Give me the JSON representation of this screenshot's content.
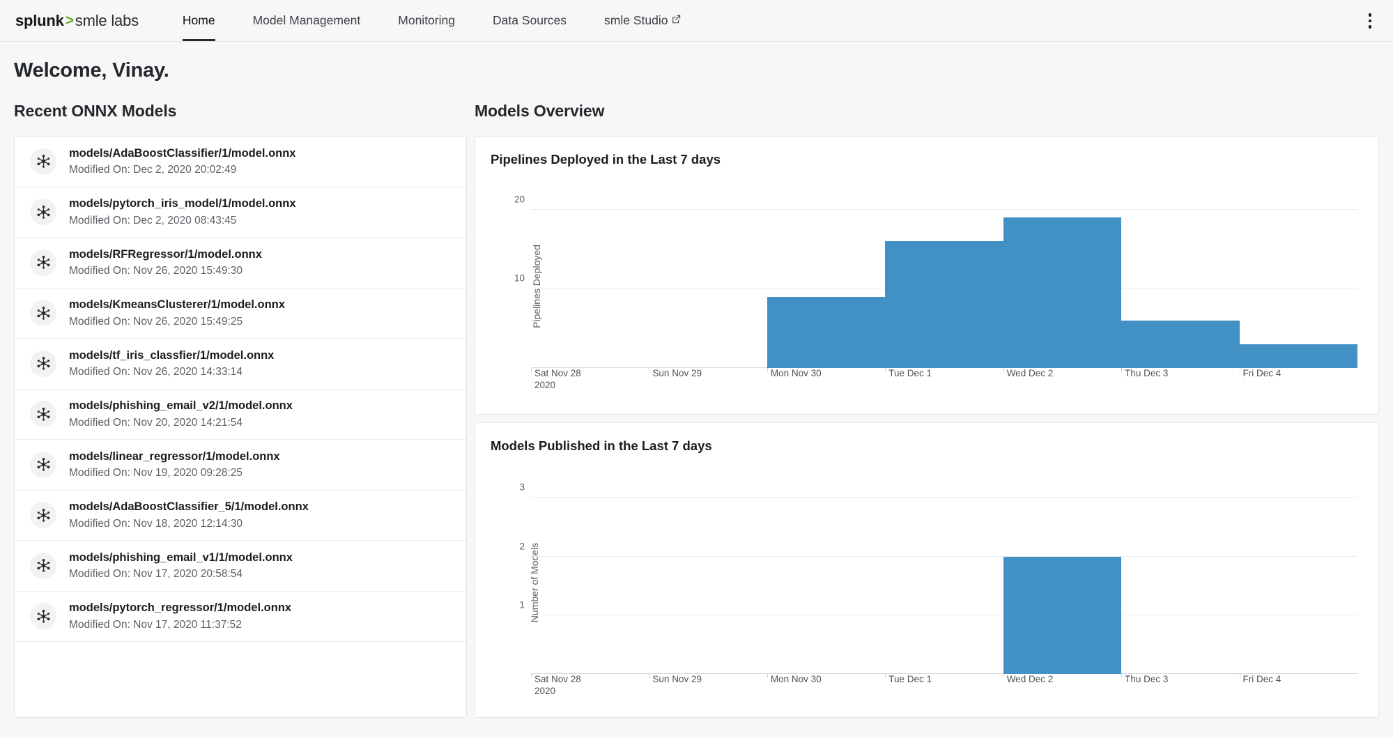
{
  "nav": {
    "brand": {
      "splunk": "splunk",
      "chevron": ">",
      "smle": "smle labs"
    },
    "items": [
      {
        "label": "Home",
        "active": true,
        "external": false
      },
      {
        "label": "Model Management",
        "active": false,
        "external": false
      },
      {
        "label": "Monitoring",
        "active": false,
        "external": false
      },
      {
        "label": "Data Sources",
        "active": false,
        "external": false
      },
      {
        "label": "smle Studio",
        "active": false,
        "external": true
      }
    ],
    "menu_icon": "kebab-menu-icon"
  },
  "page": {
    "welcome": "Welcome, Vinay.",
    "left_section_title": "Recent ONNX Models",
    "right_section_title": "Models Overview"
  },
  "models": [
    {
      "name": "models/AdaBoostClassifier/1/model.onnx",
      "modified": "Modified On: Dec 2, 2020 20:02:49",
      "icon": "node-graph-icon"
    },
    {
      "name": "models/pytorch_iris_model/1/model.onnx",
      "modified": "Modified On: Dec 2, 2020 08:43:45",
      "icon": "node-graph-icon"
    },
    {
      "name": "models/RFRegressor/1/model.onnx",
      "modified": "Modified On: Nov 26, 2020 15:49:30",
      "icon": "node-graph-icon"
    },
    {
      "name": "models/KmeansClusterer/1/model.onnx",
      "modified": "Modified On: Nov 26, 2020 15:49:25",
      "icon": "node-graph-icon"
    },
    {
      "name": "models/tf_iris_classfier/1/model.onnx",
      "modified": "Modified On: Nov 26, 2020 14:33:14",
      "icon": "node-graph-icon"
    },
    {
      "name": "models/phishing_email_v2/1/model.onnx",
      "modified": "Modified On: Nov 20, 2020 14:21:54",
      "icon": "node-graph-icon"
    },
    {
      "name": "models/linear_regressor/1/model.onnx",
      "modified": "Modified On: Nov 19, 2020 09:28:25",
      "icon": "node-graph-icon"
    },
    {
      "name": "models/AdaBoostClassifier_5/1/model.onnx",
      "modified": "Modified On: Nov 18, 2020 12:14:30",
      "icon": "node-graph-icon"
    },
    {
      "name": "models/phishing_email_v1/1/model.onnx",
      "modified": "Modified On: Nov 17, 2020 20:58:54",
      "icon": "node-graph-icon"
    },
    {
      "name": "models/pytorch_regressor/1/model.onnx",
      "modified": "Modified On: Nov 17, 2020 11:37:52",
      "icon": "node-graph-icon"
    }
  ],
  "colors": {
    "bar": "#4291c4",
    "brand_accent": "#65a637",
    "grid": "#eaeced",
    "card_border": "#e1e6eb"
  },
  "chart_data": [
    {
      "type": "bar",
      "title": "Pipelines Deployed in the Last 7 days",
      "xlabel": "",
      "ylabel": "Pipelines Deployed",
      "categories": [
        "Sat Nov 28\n2020",
        "Sun Nov 29",
        "Mon Nov 30",
        "Tue Dec 1",
        "Wed Dec 2",
        "Thu Dec 3",
        "Fri Dec 4"
      ],
      "values": [
        0,
        0,
        9,
        16,
        19,
        6,
        3
      ],
      "yticks": [
        10,
        20
      ],
      "ylim": [
        0,
        22
      ],
      "grid": true,
      "legend": false
    },
    {
      "type": "bar",
      "title": "Models Published in the Last 7 days",
      "xlabel": "",
      "ylabel": "Number of Models",
      "categories": [
        "Sat Nov 28\n2020",
        "Sun Nov 29",
        "Mon Nov 30",
        "Tue Dec 1",
        "Wed Dec 2",
        "Thu Dec 3",
        "Fri Dec 4"
      ],
      "values": [
        0,
        0,
        0,
        0,
        2,
        0,
        0
      ],
      "yticks": [
        1,
        2,
        3
      ],
      "ylim": [
        0,
        3.3
      ],
      "grid": true,
      "legend": false
    }
  ]
}
